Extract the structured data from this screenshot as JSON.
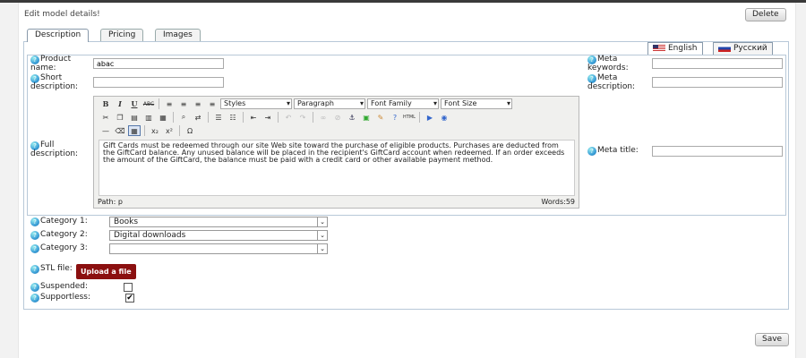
{
  "header": {
    "title": "Edit model details!",
    "delete_label": "Delete"
  },
  "tabs": [
    {
      "label": "Description",
      "active": true
    },
    {
      "label": "Pricing",
      "active": false
    },
    {
      "label": "Images",
      "active": false
    }
  ],
  "languages": [
    {
      "label": "English",
      "flag": "us-flag-icon",
      "active": true
    },
    {
      "label": "Русский",
      "flag": "ru-flag-icon",
      "active": false
    }
  ],
  "fields": {
    "product_name_label": "Product name:",
    "product_name_value": "abac",
    "short_description_label": "Short description:",
    "short_description_value": "",
    "full_description_label": "Full description:",
    "meta_keywords_label": "Meta keywords:",
    "meta_description_label": "Meta description:",
    "meta_title_label": "Meta title:"
  },
  "editor": {
    "styles": "Styles",
    "paragraph": "Paragraph",
    "font_family": "Font Family",
    "font_size": "Font Size",
    "content": "Gift Cards must be redeemed through our site Web site toward the purchase of eligible products. Purchases are deducted from the GiftCard balance. Any unused balance will be placed in the recipient's GiftCard account when redeemed. If an order exceeds the amount of the GiftCard, the balance must be paid with a credit card or other available payment method.",
    "path": "Path: p",
    "words": "Words:59"
  },
  "categories": [
    {
      "label": "Category 1:",
      "value": "Books"
    },
    {
      "label": "Category 2:",
      "value": "Digital downloads"
    },
    {
      "label": "Category 3:",
      "value": ""
    }
  ],
  "stl": {
    "label": "STL file:",
    "upload_label": "Upload a file"
  },
  "suspended": {
    "label": "Suspended:",
    "checked": false
  },
  "supportless": {
    "label": "Supportless:",
    "checked": true,
    "mark": "✔"
  },
  "save_label": "Save",
  "colors": {
    "upload_bg": "#8b1010",
    "help_icon": "#3b9fd8",
    "frame_border": "#b8c8d8"
  }
}
